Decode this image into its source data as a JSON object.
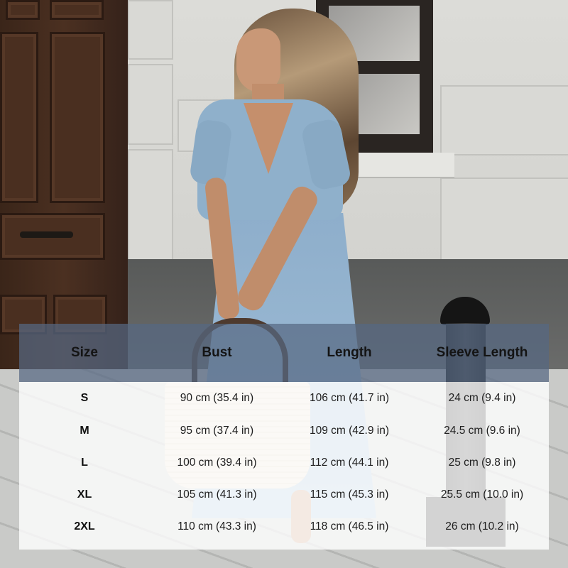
{
  "size_chart": {
    "headers": [
      "Size",
      "Bust",
      "Length",
      "Sleeve Length"
    ],
    "rows": [
      {
        "size": "S",
        "bust": "90 cm (35.4 in)",
        "length": "106 cm (41.7 in)",
        "sleeve": "24 cm (9.4 in)"
      },
      {
        "size": "M",
        "bust": "95 cm (37.4 in)",
        "length": "109 cm (42.9 in)",
        "sleeve": "24.5 cm (9.6 in)"
      },
      {
        "size": "L",
        "bust": "100 cm (39.4 in)",
        "length": "112 cm (44.1 in)",
        "sleeve": "25 cm (9.8 in)"
      },
      {
        "size": "XL",
        "bust": "105 cm (41.3 in)",
        "length": "115 cm (45.3 in)",
        "sleeve": "25.5 cm (10.0 in)"
      },
      {
        "size": "2XL",
        "bust": "110 cm (43.3 in)",
        "length": "118 cm (46.5 in)",
        "sleeve": "26 cm (10.2 in)"
      }
    ]
  },
  "colors": {
    "header_overlay": "#566882",
    "body_overlay": "#ffffff",
    "dress": "#8fb0cb"
  }
}
